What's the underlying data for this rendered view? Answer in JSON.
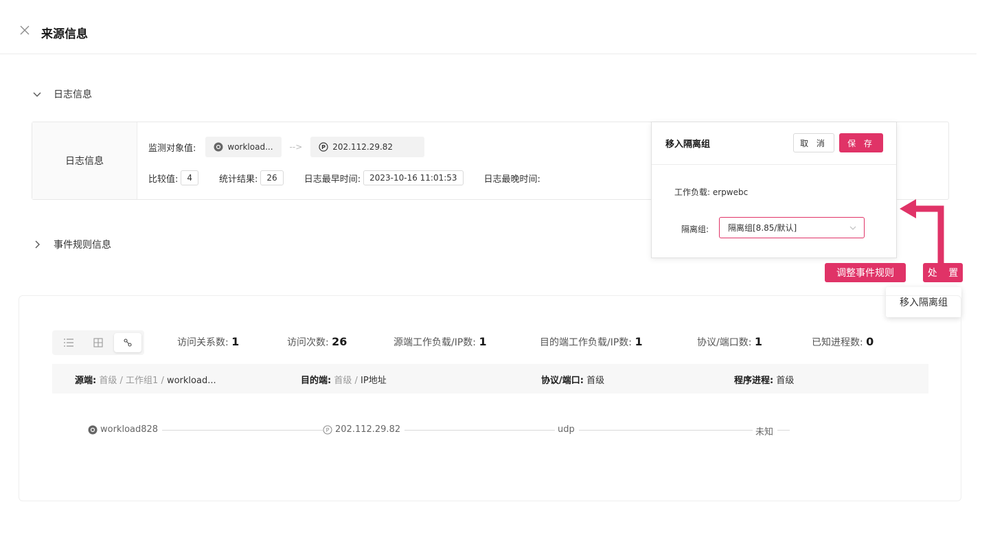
{
  "header": {
    "title": "来源信息"
  },
  "sections": {
    "log_info": "日志信息",
    "event_rule_info": "事件规则信息"
  },
  "log_box": {
    "label": "日志信息",
    "monitor_label": "监测对象值:",
    "source": "workload...",
    "target": "202.112.29.82",
    "compare_label": "比较值:",
    "compare_value": "4",
    "stat_label": "统计结果:",
    "stat_value": "26",
    "earliest_label": "日志最早时间:",
    "earliest_value": "2023-10-16 11:01:53",
    "latest_label": "日志最晚时间:"
  },
  "popover": {
    "title": "移入隔离组",
    "cancel": "取 消",
    "save": "保 存",
    "workload_label": "工作负载:",
    "workload_value": "erpwebc",
    "group_label": "隔离组:",
    "group_value": "隔离组[8.85/默认]"
  },
  "actions": {
    "adjust": "调整事件规则",
    "handle": "处 置",
    "menu_item": "移入隔离组"
  },
  "stats": {
    "relations_label": "访问关系数:",
    "relations": "1",
    "visits_label": "访问次数:",
    "visits": "26",
    "src_label": "源端工作负载/IP数:",
    "src": "1",
    "dst_label": "目的端工作负载/IP数:",
    "dst": "1",
    "proto_label": "协议/端口数:",
    "proto": "1",
    "proc_label": "已知进程数:",
    "proc": "0"
  },
  "path_bar": {
    "src_key": "源端:",
    "src_lvl1": "首级",
    "src_lvl2": "工作组1",
    "src_lvl3": "workload...",
    "dst_key": "目的端:",
    "dst_lvl1": "首级",
    "dst_lvl2": "IP地址",
    "proto_key": "协议/端口:",
    "proto_lvl": "首级",
    "proc_key": "程序进程:",
    "proc_lvl": "首级"
  },
  "flow": {
    "source": "workload828",
    "ip": "202.112.29.82",
    "protocol": "udp",
    "process": "未知"
  },
  "colors": {
    "accent": "#e03367"
  }
}
